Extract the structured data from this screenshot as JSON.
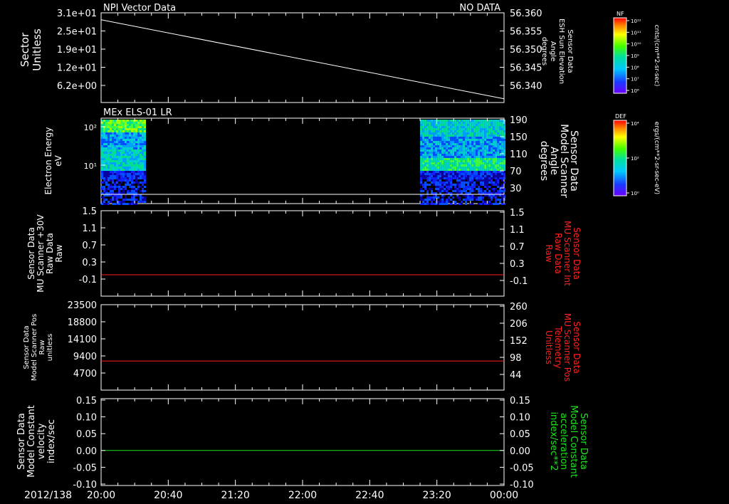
{
  "chart_data": [
    {
      "type": "line",
      "title": "NPI Vector Data",
      "status": "NO DATA",
      "ylabel": [
        "Sector",
        "Unitless"
      ],
      "y_ticks": [
        "3.1e+01",
        "2.5e+01",
        "1.9e+01",
        "1.2e+01",
        "6.2e+00"
      ],
      "ylabel_right": [
        "Sensor Data",
        "ESH Sun Elevation",
        "Angle",
        "degrees"
      ],
      "y2_ticks": [
        "56.360",
        "56.355",
        "56.350",
        "56.345",
        "56.340"
      ],
      "y2lim": [
        56.338,
        56.36
      ],
      "series": [
        {
          "x": [
            0,
            240
          ],
          "values": [
            56.3583,
            56.3389
          ],
          "color": "#ffffff"
        }
      ]
    },
    {
      "type": "heatmap",
      "title": "MEx ELS-01 LR",
      "ylabel": [
        "Electron Energy",
        "eV"
      ],
      "y_ticks": [
        "10²",
        "10¹"
      ],
      "ylabel_right": [
        "Sensor Data",
        "Model Scanner",
        "Angle",
        "degrees"
      ],
      "y2_ticks": [
        "190",
        "150",
        "110",
        "70",
        "30"
      ],
      "data_blocks": [
        {
          "x_start": 0,
          "x_end": 26
        },
        {
          "x_start": 190,
          "x_end": 240
        }
      ],
      "overlay_angle_deg": 12
    },
    {
      "type": "line",
      "ylabel": [
        "Sensor Data",
        "MU Scanner +30V",
        "Raw Data",
        "Raw"
      ],
      "y_ticks": [
        "1.5",
        "1.1",
        "0.7",
        "0.3",
        "-0.1"
      ],
      "ylabel_right": [
        "Sensor Data",
        "MU Scanner Int",
        "Raw Data",
        "Raw"
      ],
      "y2_ticks": [
        "1.5",
        "1.1",
        "0.7",
        "0.3",
        "-0.1"
      ],
      "label_color": "#ff2020",
      "series": [
        {
          "x": [
            0,
            240
          ],
          "values": [
            0.0,
            0.0
          ],
          "color": "#ff2020"
        }
      ]
    },
    {
      "type": "line",
      "ylabel": [
        "Sensor Data",
        "Model Scanner Pos",
        "Raw",
        "unitless"
      ],
      "y_ticks": [
        "23500",
        "18800",
        "14100",
        "9400",
        "4700"
      ],
      "ylabel_right": [
        "Sensor Data",
        "MU Scanner Pos",
        "Telemetry",
        "Unitless"
      ],
      "y2_ticks": [
        "260",
        "206",
        "152",
        "98",
        "44"
      ],
      "label_color": "#ff2020",
      "series": [
        {
          "x": [
            0,
            240
          ],
          "values": [
            8000,
            8000
          ],
          "color": "#ff2020"
        }
      ]
    },
    {
      "type": "line",
      "ylabel": [
        "Sensor Data",
        "Model Constant",
        "velocity",
        "index/sec"
      ],
      "y_ticks": [
        "0.15",
        "0.10",
        "0.05",
        "0.00",
        "-0.05",
        "-0.10"
      ],
      "ylabel_right": [
        "Sensor Data",
        "Model Constant",
        "acceleration",
        "index/sec**2"
      ],
      "y2_ticks": [
        "0.15",
        "0.10",
        "0.05",
        "0.00",
        "-0.05",
        "-0.10"
      ],
      "label_color": "#20e020",
      "series": [
        {
          "x": [
            0,
            240
          ],
          "values": [
            0.0,
            0.0
          ],
          "color": "#20e020"
        }
      ]
    }
  ],
  "x_axis": {
    "date_label": "2012/138",
    "tick_labels": [
      "20:00",
      "20:40",
      "21:20",
      "22:00",
      "22:40",
      "23:20",
      "00:00"
    ]
  },
  "colorbars": [
    {
      "label": "NF",
      "unit": "cnts/(cm**2-sr-sec)",
      "ticks": [
        "10¹²",
        "10¹¹",
        "10¹⁰",
        "10⁹",
        "10⁸",
        "10⁷",
        "10⁶"
      ]
    },
    {
      "label": "DEF",
      "unit": "ergs/(cm**2-sr-sec-eV)",
      "ticks": [
        "10⁴",
        "10²",
        "10⁰"
      ]
    }
  ]
}
